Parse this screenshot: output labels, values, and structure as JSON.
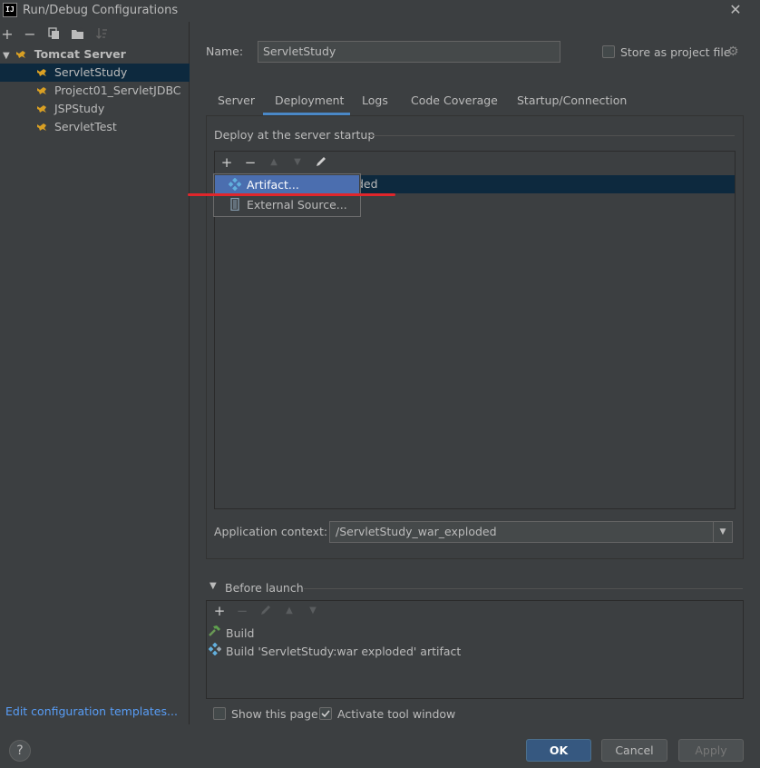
{
  "window": {
    "app_logo": "IJ",
    "title": "Run/Debug Configurations"
  },
  "sidebar": {
    "toolbar": [
      "plus-icon",
      "minus-icon",
      "copy-icon",
      "move-into-group-icon",
      "sort-icon"
    ],
    "group": {
      "label": "Tomcat Server",
      "icon": "tomcat-icon"
    },
    "items": [
      {
        "label": "ServletStudy",
        "selected": true
      },
      {
        "label": "Project01_ServletJDBC",
        "selected": false
      },
      {
        "label": "JSPStudy",
        "selected": false
      },
      {
        "label": "ServletTest",
        "selected": false
      }
    ],
    "edit_templates_link": "Edit configuration templates..."
  },
  "form": {
    "name_label": "Name:",
    "name_value": "ServletStudy",
    "store_label": "Store as project file",
    "store_checked": false
  },
  "tabs": [
    {
      "label": "Server",
      "active": false
    },
    {
      "label": "Deployment",
      "active": true
    },
    {
      "label": "Logs",
      "active": false
    },
    {
      "label": "Code Coverage",
      "active": false
    },
    {
      "label": "Startup/Connection",
      "active": false
    }
  ],
  "deployment": {
    "heading": "Deploy at the server startup",
    "row_partial_text": "ded",
    "popup_items": [
      {
        "label": "Artifact...",
        "icon": "artifact-icon",
        "highlighted": true
      },
      {
        "label": "External Source...",
        "icon": "external-source-icon",
        "highlighted": false
      }
    ],
    "app_context_label": "Application context:",
    "app_context_value": "/ServletStudy_war_exploded"
  },
  "before_launch": {
    "label": "Before launch",
    "items": [
      {
        "label": "Build",
        "icon": "hammer-icon"
      },
      {
        "label": "Build 'ServletStudy:war exploded' artifact",
        "icon": "artifact-icon"
      }
    ]
  },
  "footer": {
    "show_page_label": "Show this page",
    "show_page_checked": false,
    "activate_label": "Activate tool window",
    "activate_checked": true,
    "ok_label": "OK",
    "cancel_label": "Cancel",
    "apply_label": "Apply",
    "help_glyph": "?"
  },
  "colors": {
    "background": "#3c3f41",
    "selection": "#0d293e",
    "accent": "#4a88c7",
    "popup_highlight": "#4b6eaf",
    "annotation": "#e0262b",
    "link": "#589df6"
  }
}
